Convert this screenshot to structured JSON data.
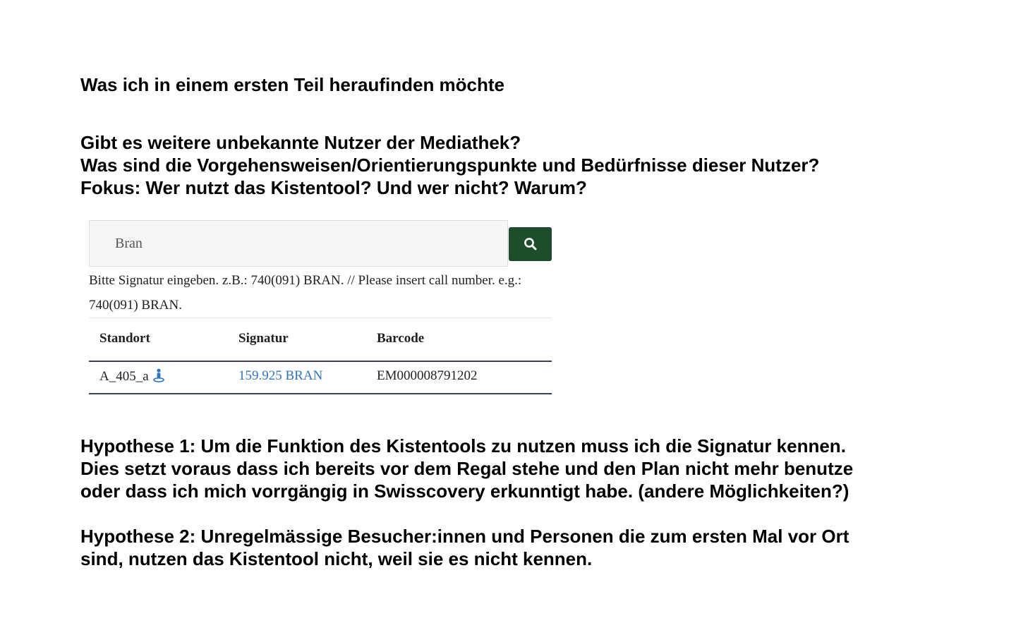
{
  "heading": "Was ich in einem ersten Teil heraufinden möchte",
  "questions": [
    "Gibt es weitere unbekannte Nutzer der Mediathek?",
    "Was sind die Vorgehensweisen/Orientierungspunkte und Bedürfnisse dieser Nutzer?",
    "Fokus: Wer nutzt das Kistentool? Und wer nicht? Warum?"
  ],
  "tool": {
    "search_value": "Bran",
    "search_button_icon": "search-icon",
    "button_color": "#1e4d2b",
    "hint_lines": [
      "Bitte Signatur eingeben. z.B.: 740(091) BRAN. // Please insert call number. e.g.:",
      "740(091) BRAN."
    ],
    "table": {
      "headers": [
        "Standort",
        "Signatur",
        "Barcode"
      ],
      "rows": [
        {
          "standort": "A_405_a",
          "standort_icon": "location-person-icon",
          "signatur": "159.925 BRAN",
          "barcode": "EM000008791202"
        }
      ]
    },
    "link_color": "#2f74c0"
  },
  "hypothesis_1": [
    "Hypothese 1: Um die Funktion des Kistentools zu nutzen muss ich die Signatur kennen.",
    "Dies setzt voraus dass ich bereits vor dem Regal stehe und den Plan nicht mehr benutze",
    "oder dass ich mich vorrgängig in Swisscovery erkunntigt habe. (andere Möglichkeiten?)"
  ],
  "hypothesis_2": [
    "Hypothese 2: Unregelmässige Besucher:innen und Personen die zum ersten Mal vor Ort",
    "sind, nutzen das Kistentool nicht, weil sie es nicht kennen."
  ]
}
